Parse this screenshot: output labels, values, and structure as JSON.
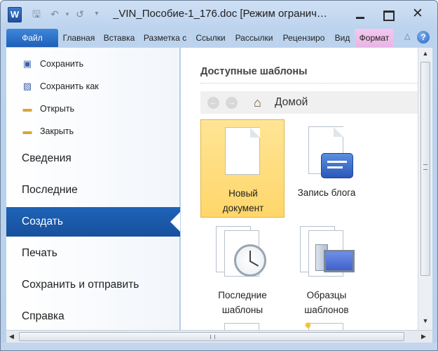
{
  "window": {
    "title": "_VIN_Пособие-1_176.doc [Режим огранич…",
    "app_logo": "W"
  },
  "qat": {
    "save_icon": "save-icon",
    "undo_icon": "undo-icon",
    "redo_icon": "redo-icon",
    "customize_icon": "customize-icon"
  },
  "ribbon": {
    "file_tab": "Файл",
    "tabs": [
      "Главная",
      "Вставка",
      "Разметка с",
      "Ссылки",
      "Рассылки",
      "Рецензиро",
      "Вид",
      "Формат"
    ]
  },
  "backstage": {
    "small_commands": [
      "Сохранить",
      "Сохранить как",
      "Открыть",
      "Закрыть"
    ],
    "big_commands": [
      "Сведения",
      "Последние",
      "Создать",
      "Печать",
      "Сохранить и отправить",
      "Справка"
    ],
    "selected": "Создать"
  },
  "templates": {
    "heading": "Доступные шаблоны",
    "location": "Домой",
    "items": [
      {
        "label_1": "Новый",
        "label_2": "документ",
        "selected": true
      },
      {
        "label_1": "Запись блога",
        "label_2": "",
        "selected": false
      },
      {
        "label_1": "Последние",
        "label_2": "шаблоны",
        "selected": false
      },
      {
        "label_1": "Образцы",
        "label_2": "шаблонов",
        "selected": false
      }
    ]
  },
  "colors": {
    "accent": "#1f63b8",
    "selection": "#ffd66a",
    "format_tab": "#e9b5e4"
  }
}
